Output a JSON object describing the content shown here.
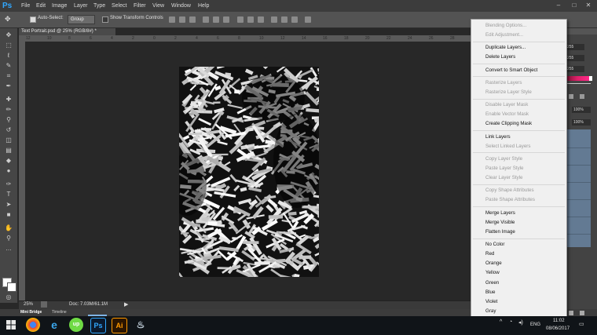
{
  "menubar": {
    "logo": "Ps",
    "items": [
      "File",
      "Edit",
      "Image",
      "Layer",
      "Type",
      "Select",
      "Filter",
      "View",
      "Window",
      "Help"
    ]
  },
  "options": {
    "auto_select_label": "Auto-Select:",
    "auto_select_value": "Group",
    "show_transform_label": "Show Transform Controls"
  },
  "document": {
    "tab_title": "Text Portrait.psd @ 25% (RGB/8#) *",
    "ruler_numbers": [
      "12",
      "10",
      "8",
      "6",
      "4",
      "2",
      "0",
      "2",
      "4",
      "6",
      "8",
      "10",
      "12",
      "14",
      "16",
      "18",
      "20",
      "22",
      "24",
      "26",
      "28"
    ],
    "zoom": "25%",
    "doc_size": "Doc: 7.03M/61.1M"
  },
  "bottom_tabs": [
    "Mini Bridge",
    "Timeline"
  ],
  "right_panel": {
    "values": [
      "255",
      "255",
      "255"
    ],
    "opacity": "100%",
    "fill": "100%"
  },
  "context_menu": {
    "items": [
      {
        "label": "Blending Options...",
        "enabled": false
      },
      {
        "label": "Edit Adjustment...",
        "enabled": false
      },
      {
        "sep": true
      },
      {
        "label": "Duplicate Layers...",
        "enabled": true
      },
      {
        "label": "Delete Layers",
        "enabled": true
      },
      {
        "sep": true
      },
      {
        "label": "Convert to Smart Object",
        "enabled": true,
        "highlighted": true
      },
      {
        "sep": true
      },
      {
        "label": "Rasterize Layers",
        "enabled": false
      },
      {
        "label": "Rasterize Layer Style",
        "enabled": false
      },
      {
        "sep": true
      },
      {
        "label": "Disable Layer Mask",
        "enabled": false
      },
      {
        "label": "Enable Vector Mask",
        "enabled": false
      },
      {
        "label": "Create Clipping Mask",
        "enabled": true
      },
      {
        "sep": true
      },
      {
        "label": "Link Layers",
        "enabled": true
      },
      {
        "label": "Select Linked Layers",
        "enabled": false
      },
      {
        "sep": true
      },
      {
        "label": "Copy Layer Style",
        "enabled": false
      },
      {
        "label": "Paste Layer Style",
        "enabled": false
      },
      {
        "label": "Clear Layer Style",
        "enabled": false
      },
      {
        "sep": true
      },
      {
        "label": "Copy Shape Attributes",
        "enabled": false
      },
      {
        "label": "Paste Shape Attributes",
        "enabled": false
      },
      {
        "sep": true
      },
      {
        "label": "Merge Layers",
        "enabled": true
      },
      {
        "label": "Merge Visible",
        "enabled": true
      },
      {
        "label": "Flatten Image",
        "enabled": true
      },
      {
        "sep": true
      },
      {
        "label": "No Color",
        "enabled": true
      },
      {
        "label": "Red",
        "enabled": true
      },
      {
        "label": "Orange",
        "enabled": true
      },
      {
        "label": "Yellow",
        "enabled": true
      },
      {
        "label": "Green",
        "enabled": true
      },
      {
        "label": "Blue",
        "enabled": true
      },
      {
        "label": "Violet",
        "enabled": true
      },
      {
        "label": "Gray",
        "enabled": true
      }
    ]
  },
  "taskbar": {
    "language": "ENG",
    "time": "11:02",
    "date": "08/06/2017",
    "apps": [
      "windows-start",
      "chrome",
      "internet-explorer",
      "upwork",
      "photoshop",
      "illustrator",
      "steam"
    ]
  },
  "colors": {
    "highlight": "#99c9ef",
    "ps_blue": "#31a8ff",
    "layer_blue": "#637a93"
  }
}
